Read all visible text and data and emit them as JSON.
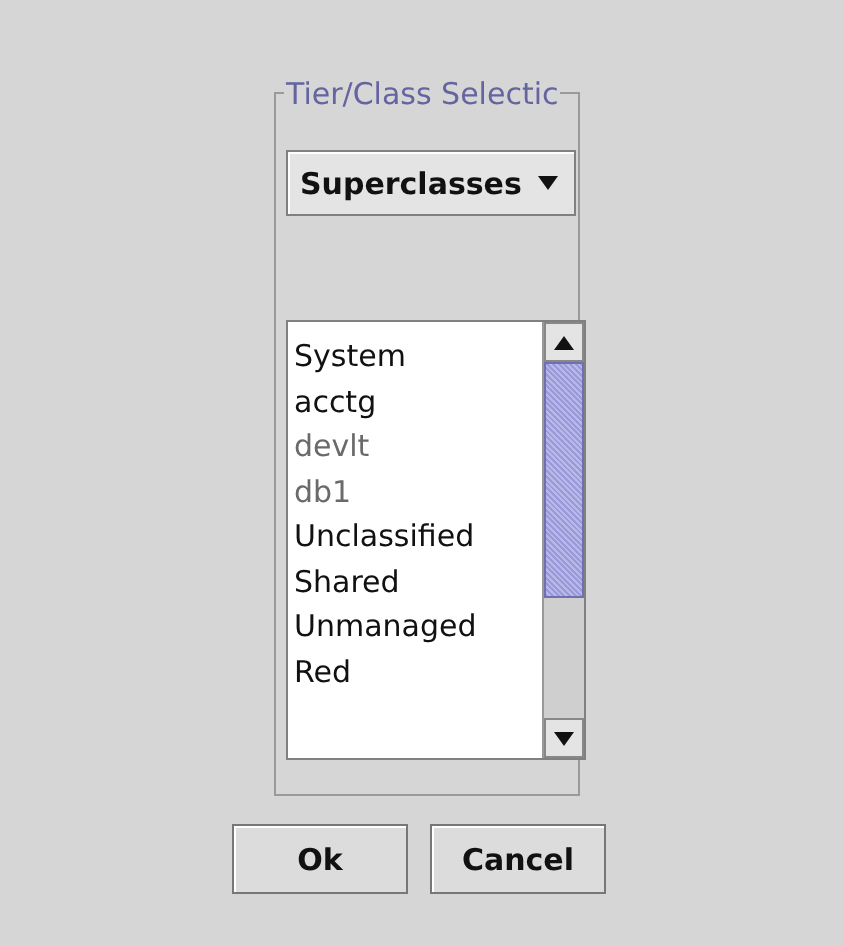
{
  "group": {
    "title": "Tier/Class Selectic"
  },
  "dropdown": {
    "value": "Superclasses"
  },
  "list": {
    "items": [
      {
        "label": "System",
        "disabled": false
      },
      {
        "label": "acctg",
        "disabled": false
      },
      {
        "label": "devlt",
        "disabled": true
      },
      {
        "label": "db1",
        "disabled": true
      },
      {
        "label": "Unclassified",
        "disabled": false
      },
      {
        "label": "Shared",
        "disabled": false
      },
      {
        "label": "Unmanaged",
        "disabled": false
      },
      {
        "label": "Red",
        "disabled": false
      }
    ]
  },
  "buttons": [
    "Ok",
    "Cancel"
  ]
}
